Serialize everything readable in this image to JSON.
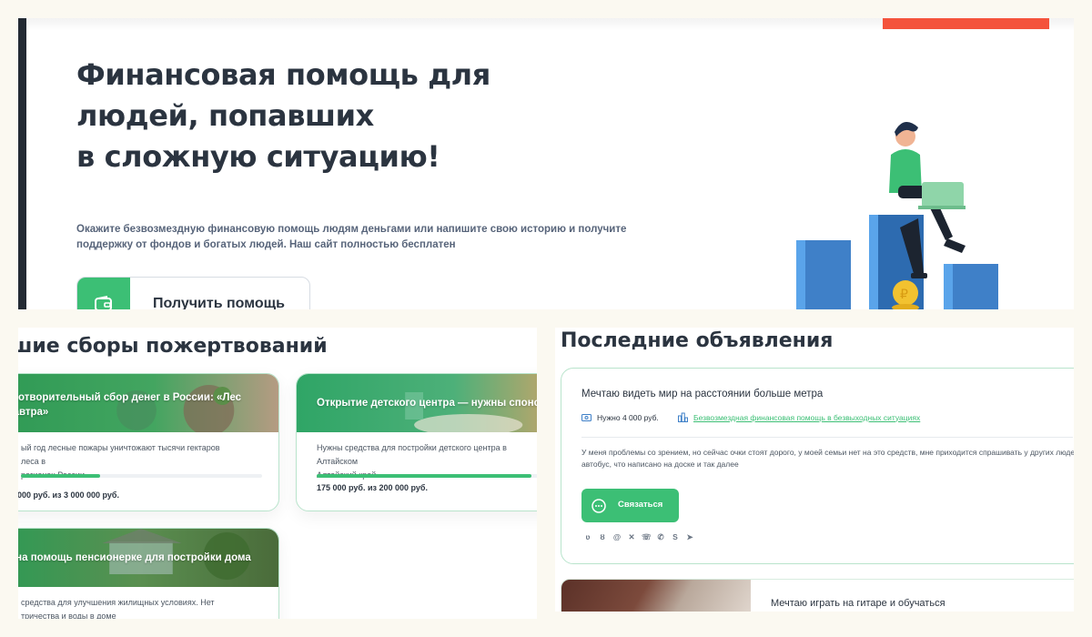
{
  "hero": {
    "title_line1": "Финансовая помощь для",
    "title_line2": "людей, попавших",
    "title_line3": "в сложную ситуацию!",
    "description_line1": "Окажите безвозмездную финансовую помощь людям деньгами или напишите свою историю и получите",
    "description_line2": "поддержку от фондов и богатых людей. Наш сайт полностью бесплатен",
    "help_button_label": "Получить помощь"
  },
  "fundraisers": {
    "section_title": "шие сборы пожертвований",
    "cards": [
      {
        "title_line1": "аготворительный сбор денег в России: «Лес",
        "title_line2": "завтра»",
        "description_line1": "ый год лесные пожары уничтожают тысячи гектаров леса в",
        "description_line2": "регионах России.",
        "progress": 0.33,
        "sum": " 000 руб. из 3 000 000 руб."
      },
      {
        "title_line1": "Открытие детского центра — нужны спонс",
        "description_line1": "Нужны средства для постройки детского центра в Алтайском",
        "description_line2": "Алтайский край",
        "progress": 0.875,
        "sum": "175 000 руб. из 200 000 руб."
      },
      {
        "title_line1": "жна помощь пенсионерке для постройки дома",
        "description_line1": "средства для улучшения жилищных условиях. Нет",
        "description_line2": "тричества и воды в доме"
      }
    ]
  },
  "announcements": {
    "section_title": "Последние объявления",
    "cards": [
      {
        "title": "Мечтаю видеть мир на расстоянии больше метра",
        "need": "Нужно 4 000 руб.",
        "category": "Безвозмездная финансовая помощь в безвыходных ситуациях",
        "text_line1": "У меня проблемы со зрением, но сейчас очки стоят дорого, у моей семьи нет на это средств, мне приходится спрашивать у других людей, к",
        "text_line2": "автобус, что написано на доске и так далее",
        "contact_label": "Связаться",
        "share_icons": [
          "vk-icon",
          "ok-icon",
          "moimir-icon",
          "x-icon",
          "viber-icon",
          "whatsapp-icon",
          "skype-icon",
          "telegram-icon"
        ]
      },
      {
        "title": "Мечтаю играть на гитаре и обучаться"
      }
    ]
  },
  "colors": {
    "accent_green": "#3cbf75",
    "dark_text": "#2b3440",
    "red": "#f4533c",
    "page_background": "#fbf9f1"
  }
}
